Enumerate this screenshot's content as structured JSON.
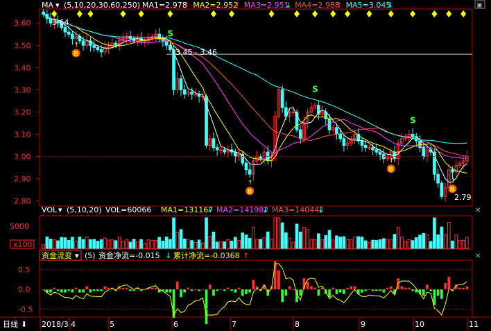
{
  "header": {
    "ind_name": "MA",
    "ind_params": "(5,10,20,30,60,250)",
    "ma": [
      {
        "label": "MA1=2.978",
        "arrow": "↑",
        "color": "#ffffff",
        "arrow_color": "#ff3030"
      },
      {
        "label": "MA2=2.952",
        "arrow": "↑",
        "color": "#ffff00",
        "arrow_color": "#ff3030"
      },
      {
        "label": "MA3=2.951",
        "arrow": "↓",
        "color": "#ff40ff",
        "arrow_color": "#00ffff"
      },
      {
        "label": "MA4=2.988",
        "arrow": "↑",
        "color": "#ff5050",
        "arrow_color": "#ff3030"
      },
      {
        "label": "MA5=3.045",
        "arrow": "↓",
        "color": "#40ffff",
        "arrow_color": "#00ffff"
      }
    ]
  },
  "vol_header": {
    "name": "VOL",
    "params": "(5,10,20)",
    "vol": "VOL=60066",
    "ma": [
      {
        "label": "MA1=131167",
        "arrow": "↓",
        "color": "#ffff00"
      },
      {
        "label": "MA2=141982",
        "arrow": "↓",
        "color": "#ff40ff"
      },
      {
        "label": "MA3=140442",
        "arrow": "↓",
        "color": "#ff5050"
      }
    ]
  },
  "flow_header": {
    "name": "资金流变",
    "params": "(5)",
    "net": "资金净流=-0.015",
    "net_arrow": "↓",
    "cum": "累计净流=-0.0368",
    "cum_arrow": "↑"
  },
  "bottom": {
    "period": "日线",
    "labels": [
      "2018/3",
      "4",
      "5",
      "6",
      "7",
      "8",
      "9",
      "10",
      "11"
    ]
  },
  "annotations": {
    "hi_label": "3.64",
    "range_label": "3.45 - 3.46",
    "lo_label": "2.79",
    "s_mark": "S",
    "b_mark": "B"
  },
  "vol_axis": {
    "top": "5000",
    "unit": "x100"
  },
  "colors": {
    "up": "#ff3030",
    "down": "#40ffff",
    "grid": "#8b0000",
    "axis": "#c00000",
    "text": "#ffffff"
  },
  "chart_data": {
    "type": "candlestick",
    "price_ticks": [
      "3.60",
      "3.50",
      "3.40",
      "3.30",
      "3.20",
      "3.10",
      "3.00",
      "2.90",
      "2.80"
    ],
    "price_range": [
      2.78,
      3.66
    ],
    "months": [
      "2018/3",
      "4",
      "5",
      "6",
      "7",
      "8",
      "9",
      "10",
      "11"
    ],
    "closes": [
      3.64,
      3.62,
      3.6,
      3.61,
      3.6,
      3.58,
      3.56,
      3.55,
      3.53,
      3.54,
      3.52,
      3.5,
      3.52,
      3.5,
      3.49,
      3.48,
      3.47,
      3.49,
      3.5,
      3.51,
      3.5,
      3.52,
      3.53,
      3.54,
      3.53,
      3.52,
      3.53,
      3.52,
      3.52,
      3.53,
      3.54,
      3.55,
      3.53,
      3.52,
      3.5,
      3.48,
      3.3,
      3.35,
      3.3,
      3.28,
      3.29,
      3.28,
      3.28,
      3.27,
      3.27,
      3.05,
      3.08,
      3.04,
      3.03,
      3.03,
      3.02,
      3.03,
      3.02,
      3.0,
      3.01,
      2.97,
      2.94,
      2.92,
      2.98,
      3.0,
      2.99,
      3.02,
      2.98,
      3.0,
      3.18,
      3.3,
      3.22,
      3.18,
      3.2,
      3.2,
      3.12,
      3.08,
      3.15,
      3.2,
      3.22,
      3.23,
      3.19,
      3.2,
      3.17,
      3.12,
      3.13,
      3.1,
      3.08,
      3.05,
      3.06,
      3.08,
      3.1,
      3.07,
      3.05,
      3.04,
      3.04,
      3.03,
      3.02,
      3.01,
      2.99,
      3.0,
      3.02,
      2.99,
      3.06,
      3.08,
      3.09,
      3.1,
      3.09,
      3.07,
      3.04,
      3.0,
      3.03,
      3.02,
      2.92,
      2.88,
      2.82,
      2.86,
      2.94,
      2.93,
      2.96,
      2.97,
      2.98,
      3.0
    ],
    "volume_ticks": [
      "5000"
    ],
    "flow_ticks": [
      "0.5",
      "0.0",
      "-0.5"
    ],
    "flow_range": [
      -0.65,
      0.65
    ]
  }
}
